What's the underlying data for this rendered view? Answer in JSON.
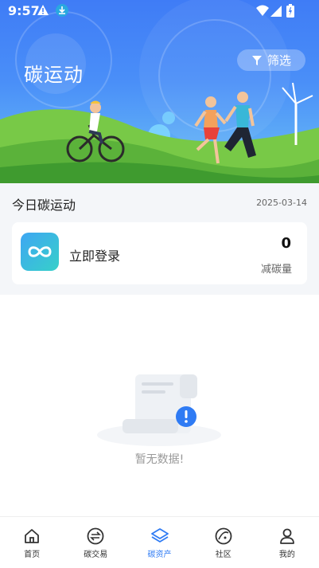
{
  "status_bar": {
    "time": "9:57"
  },
  "hero": {
    "title": "碳运动",
    "filter_label": "筛选"
  },
  "section": {
    "title": "今日碳运动",
    "date": "2025-03-14",
    "card": {
      "action_label": "立即登录",
      "value": "0",
      "value_label": "减碳量"
    }
  },
  "empty_state": {
    "text": "暂无数据!"
  },
  "tabbar": {
    "active_index": 2,
    "tabs": [
      {
        "label": "首页",
        "icon": "home-icon"
      },
      {
        "label": "碳交易",
        "icon": "exchange-icon"
      },
      {
        "label": "碳资产",
        "icon": "layers-icon"
      },
      {
        "label": "社区",
        "icon": "community-icon"
      },
      {
        "label": "我的",
        "icon": "person-icon"
      }
    ]
  },
  "colors": {
    "accent": "#2f7bf4",
    "hero_top": "#3f7cf6",
    "hero_bottom": "#6cc1f6",
    "logo_start": "#3ea6f3",
    "logo_end": "#37d0c9"
  }
}
